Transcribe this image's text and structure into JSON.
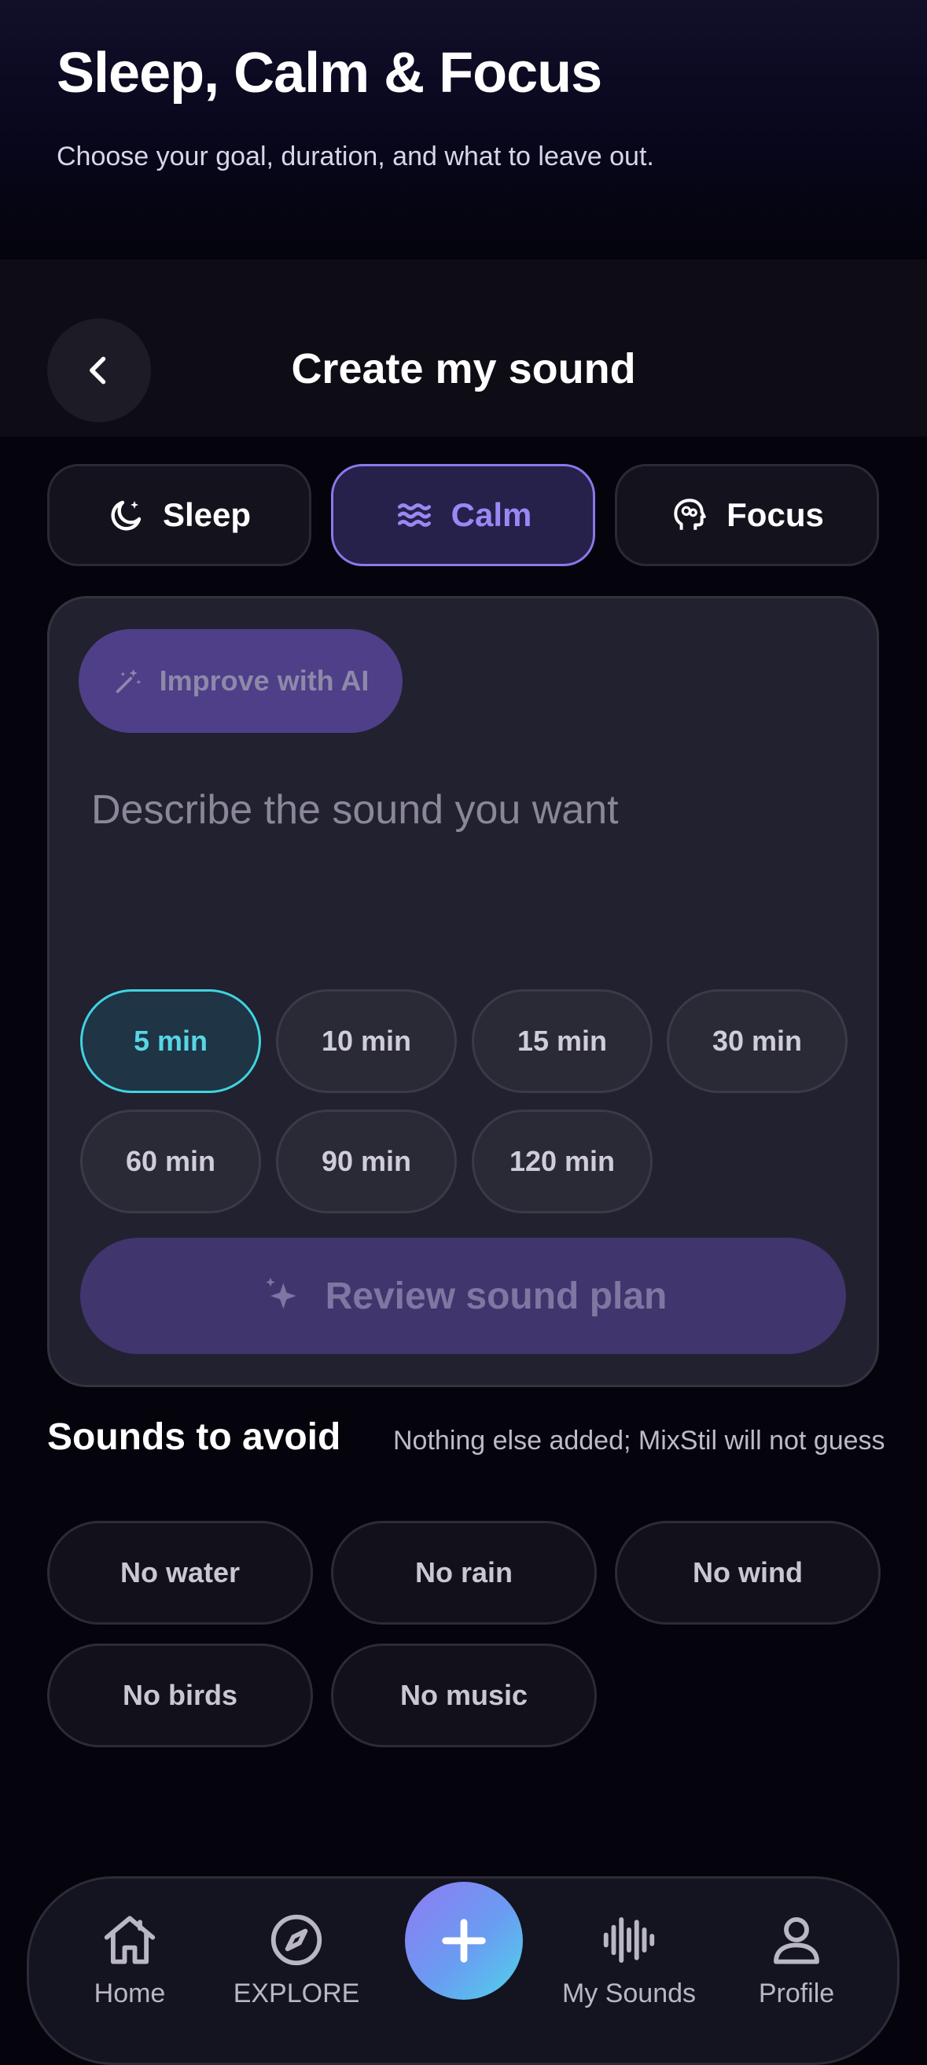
{
  "header": {
    "title": "Sleep, Calm & Focus",
    "subtitle": "Choose your goal, duration, and what to leave out."
  },
  "topbar": {
    "title": "Create my sound"
  },
  "modes": [
    {
      "label": "Sleep",
      "icon": "moon-icon",
      "active": false
    },
    {
      "label": "Calm",
      "icon": "waves-icon",
      "active": true
    },
    {
      "label": "Focus",
      "icon": "brain-head-icon",
      "active": false
    }
  ],
  "composer": {
    "ai_button": "Improve with AI",
    "placeholder": "Describe the sound you want",
    "durations": [
      {
        "label": "5 min",
        "selected": true
      },
      {
        "label": "10 min",
        "selected": false
      },
      {
        "label": "15 min",
        "selected": false
      },
      {
        "label": "30 min",
        "selected": false
      },
      {
        "label": "60 min",
        "selected": false
      },
      {
        "label": "90 min",
        "selected": false
      },
      {
        "label": "120 min",
        "selected": false
      }
    ],
    "review_button": "Review sound plan"
  },
  "avoid": {
    "title": "Sounds to avoid",
    "note": "Nothing else added; MixStil will not guess",
    "options": [
      "No water",
      "No rain",
      "No wind",
      "No birds",
      "No music"
    ]
  },
  "nav": {
    "items": [
      {
        "label": "Home",
        "icon": "home-icon"
      },
      {
        "label": "EXPLORE",
        "icon": "compass-icon"
      },
      {
        "label": "My Sounds",
        "icon": "waveform-icon"
      },
      {
        "label": "Profile",
        "icon": "user-icon"
      }
    ],
    "fab_icon": "plus-icon"
  },
  "colors": {
    "accent_purple": "#8d77ea",
    "accent_cyan": "#40d3e0",
    "background": "#05040c"
  }
}
